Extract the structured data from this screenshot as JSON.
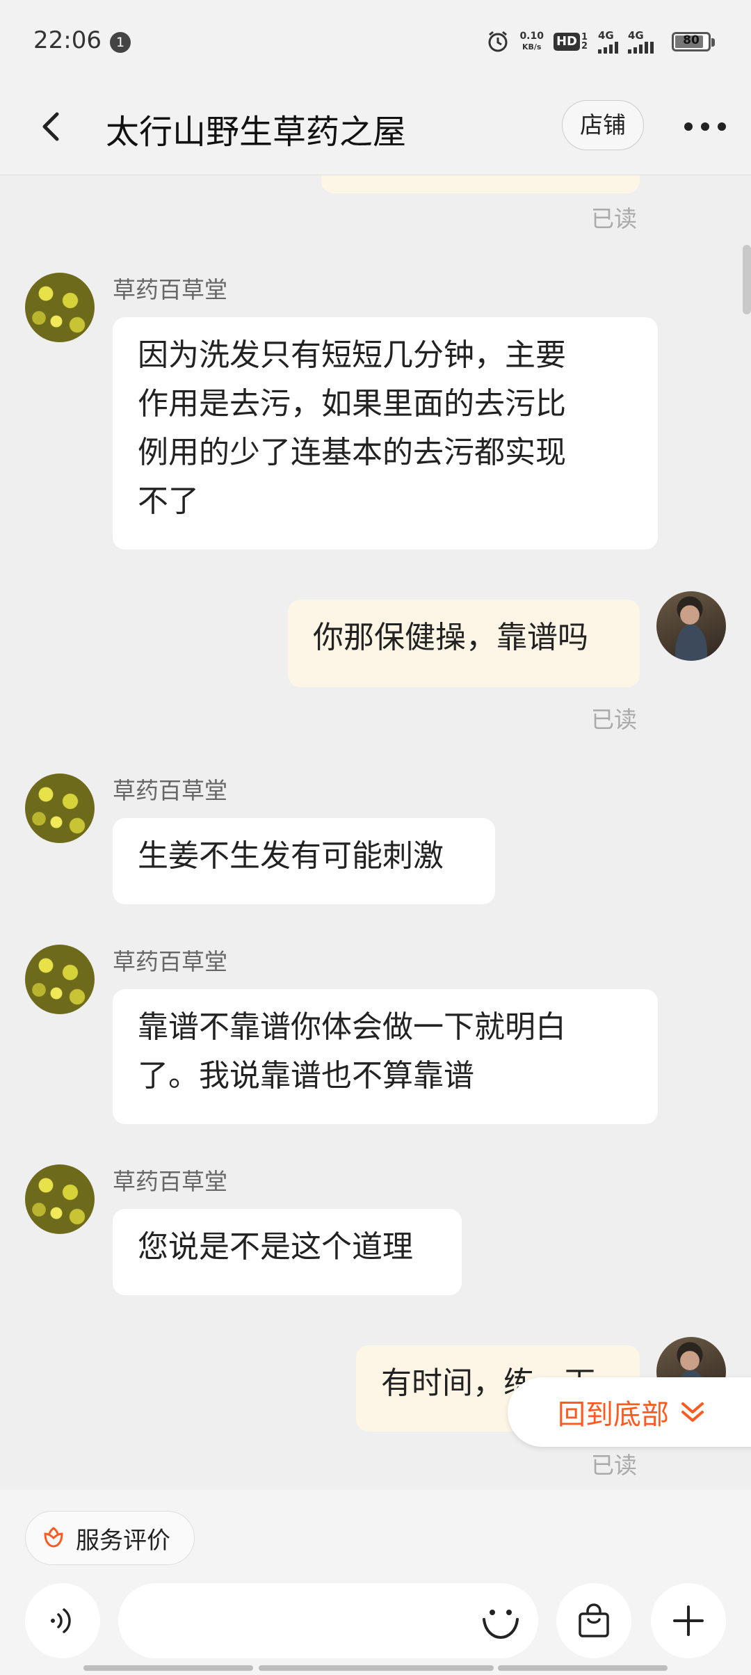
{
  "status": {
    "time": "22:06",
    "notif_count": "1",
    "speed": "0.10",
    "speed_unit": "KB/s",
    "hd": "HD",
    "hd_sub": "1 2",
    "net1": "4G",
    "net2": "4G",
    "battery": "80"
  },
  "header": {
    "title": "太行山野生草药之屋",
    "shop_label": "店铺"
  },
  "messages": [
    {
      "read": "已读"
    },
    {
      "sender": "草药百草堂",
      "text": "因为洗发只有短短几分钟，主要\n作用是去污，如果里面的去污比\n例用的少了连基本的去污都实现\n不了"
    },
    {
      "text": "你那保健操，靠谱吗",
      "read": "已读"
    },
    {
      "sender": "草药百草堂",
      "text": "生姜不生发有可能刺激"
    },
    {
      "sender": "草药百草堂",
      "text": "靠谱不靠谱你体会做一下就明白\n了。我说靠谱也不算靠谱"
    },
    {
      "sender": "草药百草堂",
      "text": "您说是不是这个道理"
    },
    {
      "text": "有时间，练一下",
      "read": "已读"
    }
  ],
  "jump_label": "回到底部",
  "bottom": {
    "service_label": "服务评价"
  },
  "colors": {
    "accent": "#ff5a1f",
    "bubble_out": "#fdf6e7",
    "bubble_in": "#ffffff",
    "background": "#efefef"
  }
}
